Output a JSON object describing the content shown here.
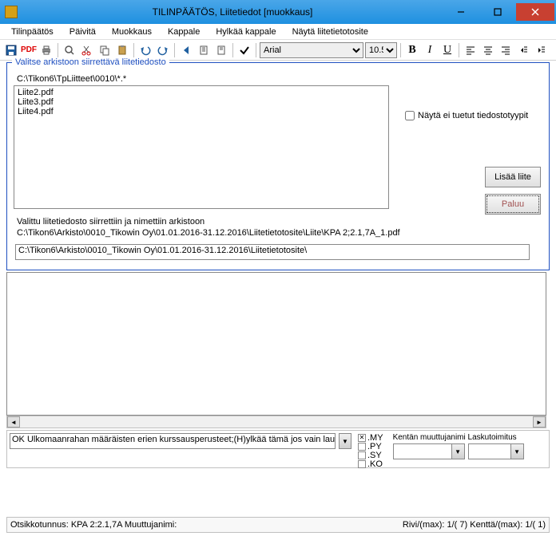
{
  "window": {
    "title": "TILINPÄÄTÖS, Liitetiedot [muokkaus]"
  },
  "menu": {
    "items": [
      "Tilinpäätös",
      "Päivitä",
      "Muokkaus",
      "Kappale",
      "Hylkää kappale",
      "Näytä liitetietotosite"
    ]
  },
  "toolbar": {
    "pdf": "PDF",
    "font_name": "Arial",
    "font_size": "10.5"
  },
  "fieldset": {
    "legend": "Valitse arkistoon siirrettävä liitetiedosto",
    "path_label": "C:\\Tikon6\\TpLiitteet\\0010\\*.*",
    "files": [
      "Liite2.pdf",
      "Liite3.pdf",
      "Liite4.pdf"
    ],
    "checkbox_label": "Näytä ei tuetut tiedostotyypit",
    "btn_add": "Lisää liite",
    "btn_return": "Paluu",
    "info_line1": "Valittu liitetiedosto siirrettiin ja nimettiin arkistoon",
    "info_line2": "C:\\Tikon6\\Arkisto\\0010_Tikowin Oy\\01.01.2016-31.12.2016\\Liitetietotosite\\Liite\\KPA 2;2.1,7A_1.pdf",
    "path_input": "C:\\Tikon6\\Arkisto\\0010_Tikowin Oy\\01.01.2016-31.12.2016\\Liitetietotosite\\"
  },
  "bottom": {
    "input": "OK Ulkomaanrahan määräisten erien kurssausperusteet;(H)ylkää tämä jos vain lauseke",
    "exts": [
      ".MY",
      ".PY",
      ".SY",
      ".KO"
    ],
    "ext_checked": 0,
    "right_label": "Kentän muuttujanimi Laskutoimitus"
  },
  "status": {
    "left": "Otsikkotunnus: KPA 2:2.1,7A Muuttujanimi:",
    "right": "Rivi/(max): 1/( 7)   Kenttä/(max): 1/( 1)"
  }
}
